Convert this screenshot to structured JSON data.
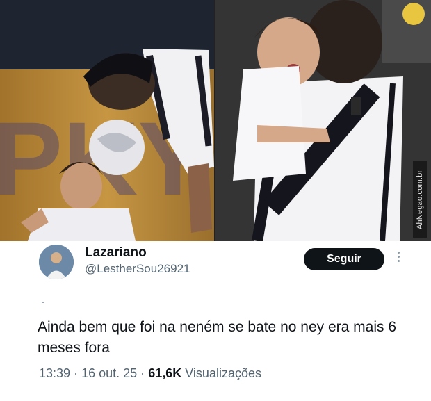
{
  "photos": {
    "left": {
      "scene": "man-heading-ball-toward-toddler",
      "banner_text": "PKY",
      "colors": {
        "banner": "#b88a3a",
        "shirt": "#f1f1f3",
        "stripe": "#1c1c26"
      }
    },
    "right": {
      "scene": "man-holding-crying-toddler",
      "colors": {
        "shirt": "#f3f3f5",
        "stripe": "#15151d",
        "background": "#343434"
      }
    },
    "watermark": "AhNegao.com.br"
  },
  "tweet": {
    "display_name": "Lazariano",
    "handle": "@LestherSou26921",
    "follow_label": "Seguir",
    "text": "Ainda bem que foi na neném se bate no ney era mais 6 meses fora",
    "time": "13:39",
    "date": "16 out. 25",
    "separator": "·",
    "views_count": "61,6K",
    "views_label": "Visualizações"
  },
  "icons": {
    "more": "more-vertical-icon",
    "avatar": "avatar-image"
  }
}
